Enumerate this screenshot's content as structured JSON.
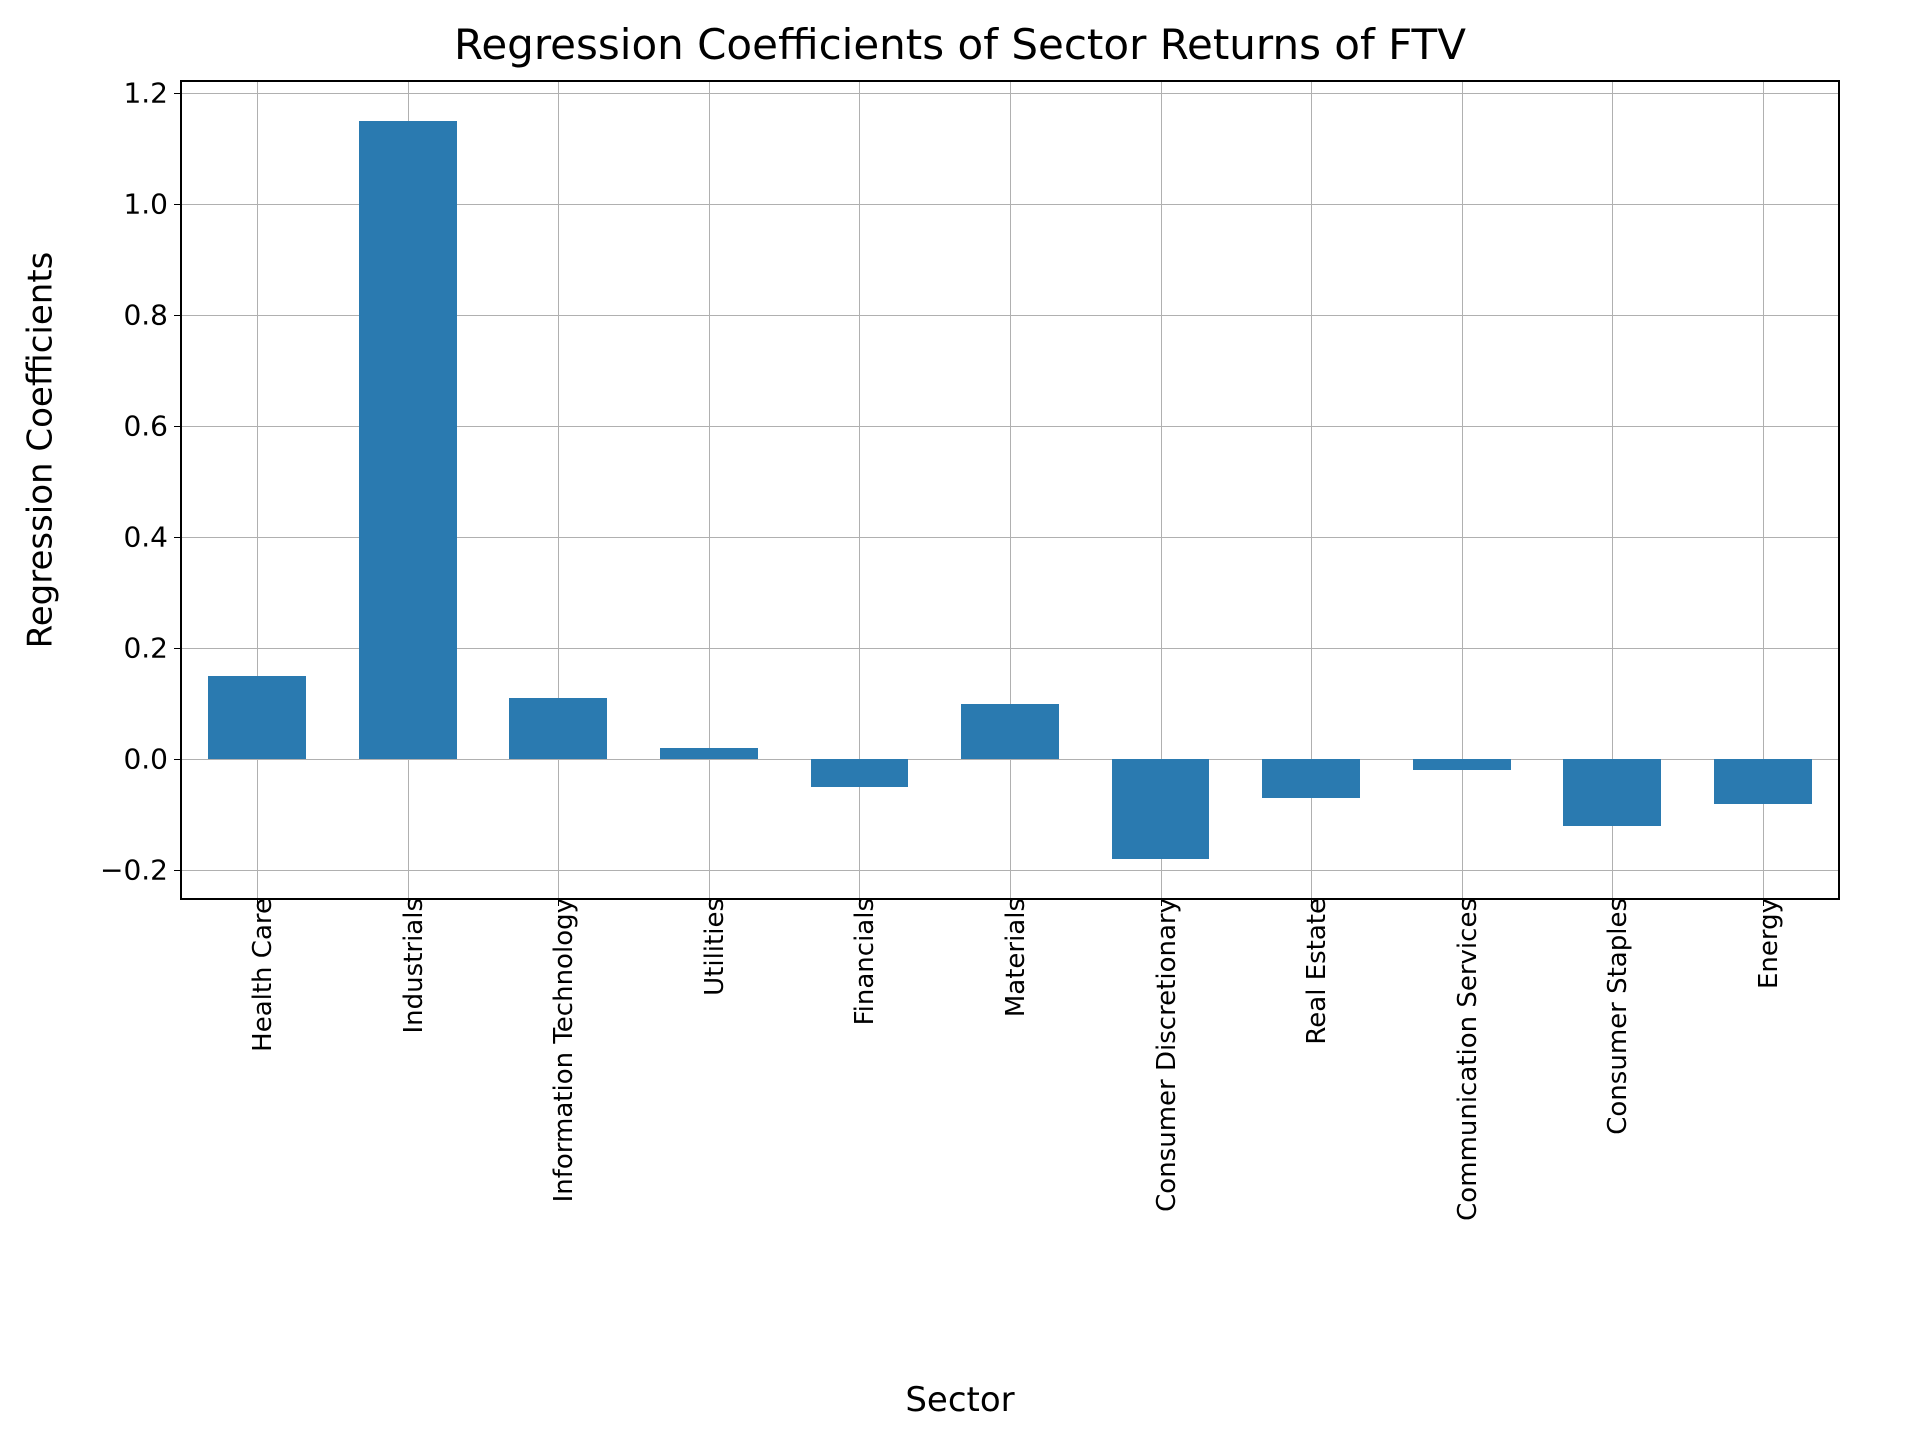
{
  "chart_data": {
    "type": "bar",
    "title": "Regression Coefficients of Sector Returns of FTV",
    "xlabel": "Sector",
    "ylabel": "Regression Coefficients",
    "categories": [
      "Health Care",
      "Industrials",
      "Information Technology",
      "Utilities",
      "Financials",
      "Materials",
      "Consumer Discretionary",
      "Real Estate",
      "Communication Services",
      "Consumer Staples",
      "Energy"
    ],
    "values": [
      0.15,
      1.15,
      0.11,
      0.02,
      -0.05,
      0.1,
      -0.18,
      -0.07,
      -0.02,
      -0.12,
      -0.08
    ],
    "ylim": [
      -0.25,
      1.22
    ],
    "yticks": [
      -0.2,
      0.0,
      0.2,
      0.4,
      0.6,
      0.8,
      1.0,
      1.2
    ],
    "ytick_labels": [
      "−0.2",
      "0.0",
      "0.2",
      "0.4",
      "0.6",
      "0.8",
      "1.0",
      "1.2"
    ],
    "bar_color": "#2a7ab0",
    "grid": true
  }
}
